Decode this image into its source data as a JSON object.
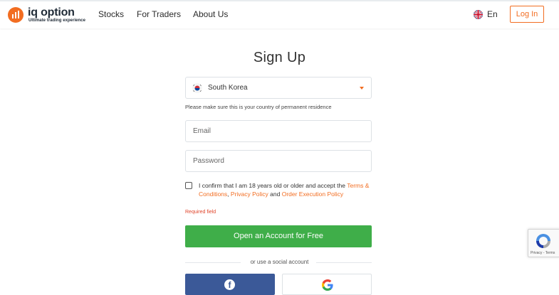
{
  "header": {
    "logo": {
      "name": "iq option",
      "tagline": "Ultimate trading experience"
    },
    "nav": [
      {
        "label": "Stocks"
      },
      {
        "label": "For Traders"
      },
      {
        "label": "About Us"
      }
    ],
    "language": {
      "label": "En",
      "icon": "uk-flag-icon"
    },
    "login_label": "Log In"
  },
  "form": {
    "title": "Sign Up",
    "country": {
      "value": "South Korea",
      "icon": "south-korea-flag-icon"
    },
    "country_hint": "Please make sure this is your country of permanent residence",
    "email_placeholder": "Email",
    "password_placeholder": "Password",
    "consent": {
      "text_before": "I confirm that I am 18 years old or older and accept the ",
      "terms_link": "Terms & Conditions",
      "comma": ", ",
      "privacy_link": "Privacy Policy",
      "and": " and ",
      "order_link": "Order Execution Policy"
    },
    "required_text": "Required field",
    "submit_label": "Open an Account for Free",
    "social_divider": "or use a social account",
    "social": [
      {
        "icon": "facebook-icon"
      },
      {
        "icon": "google-icon"
      }
    ]
  },
  "recaptcha": {
    "label": "Privacy - Terms"
  },
  "colors": {
    "brand_orange": "#f26d21",
    "cta_green": "#3fae49",
    "facebook_blue": "#3b5998",
    "error_red": "#e0452b"
  }
}
